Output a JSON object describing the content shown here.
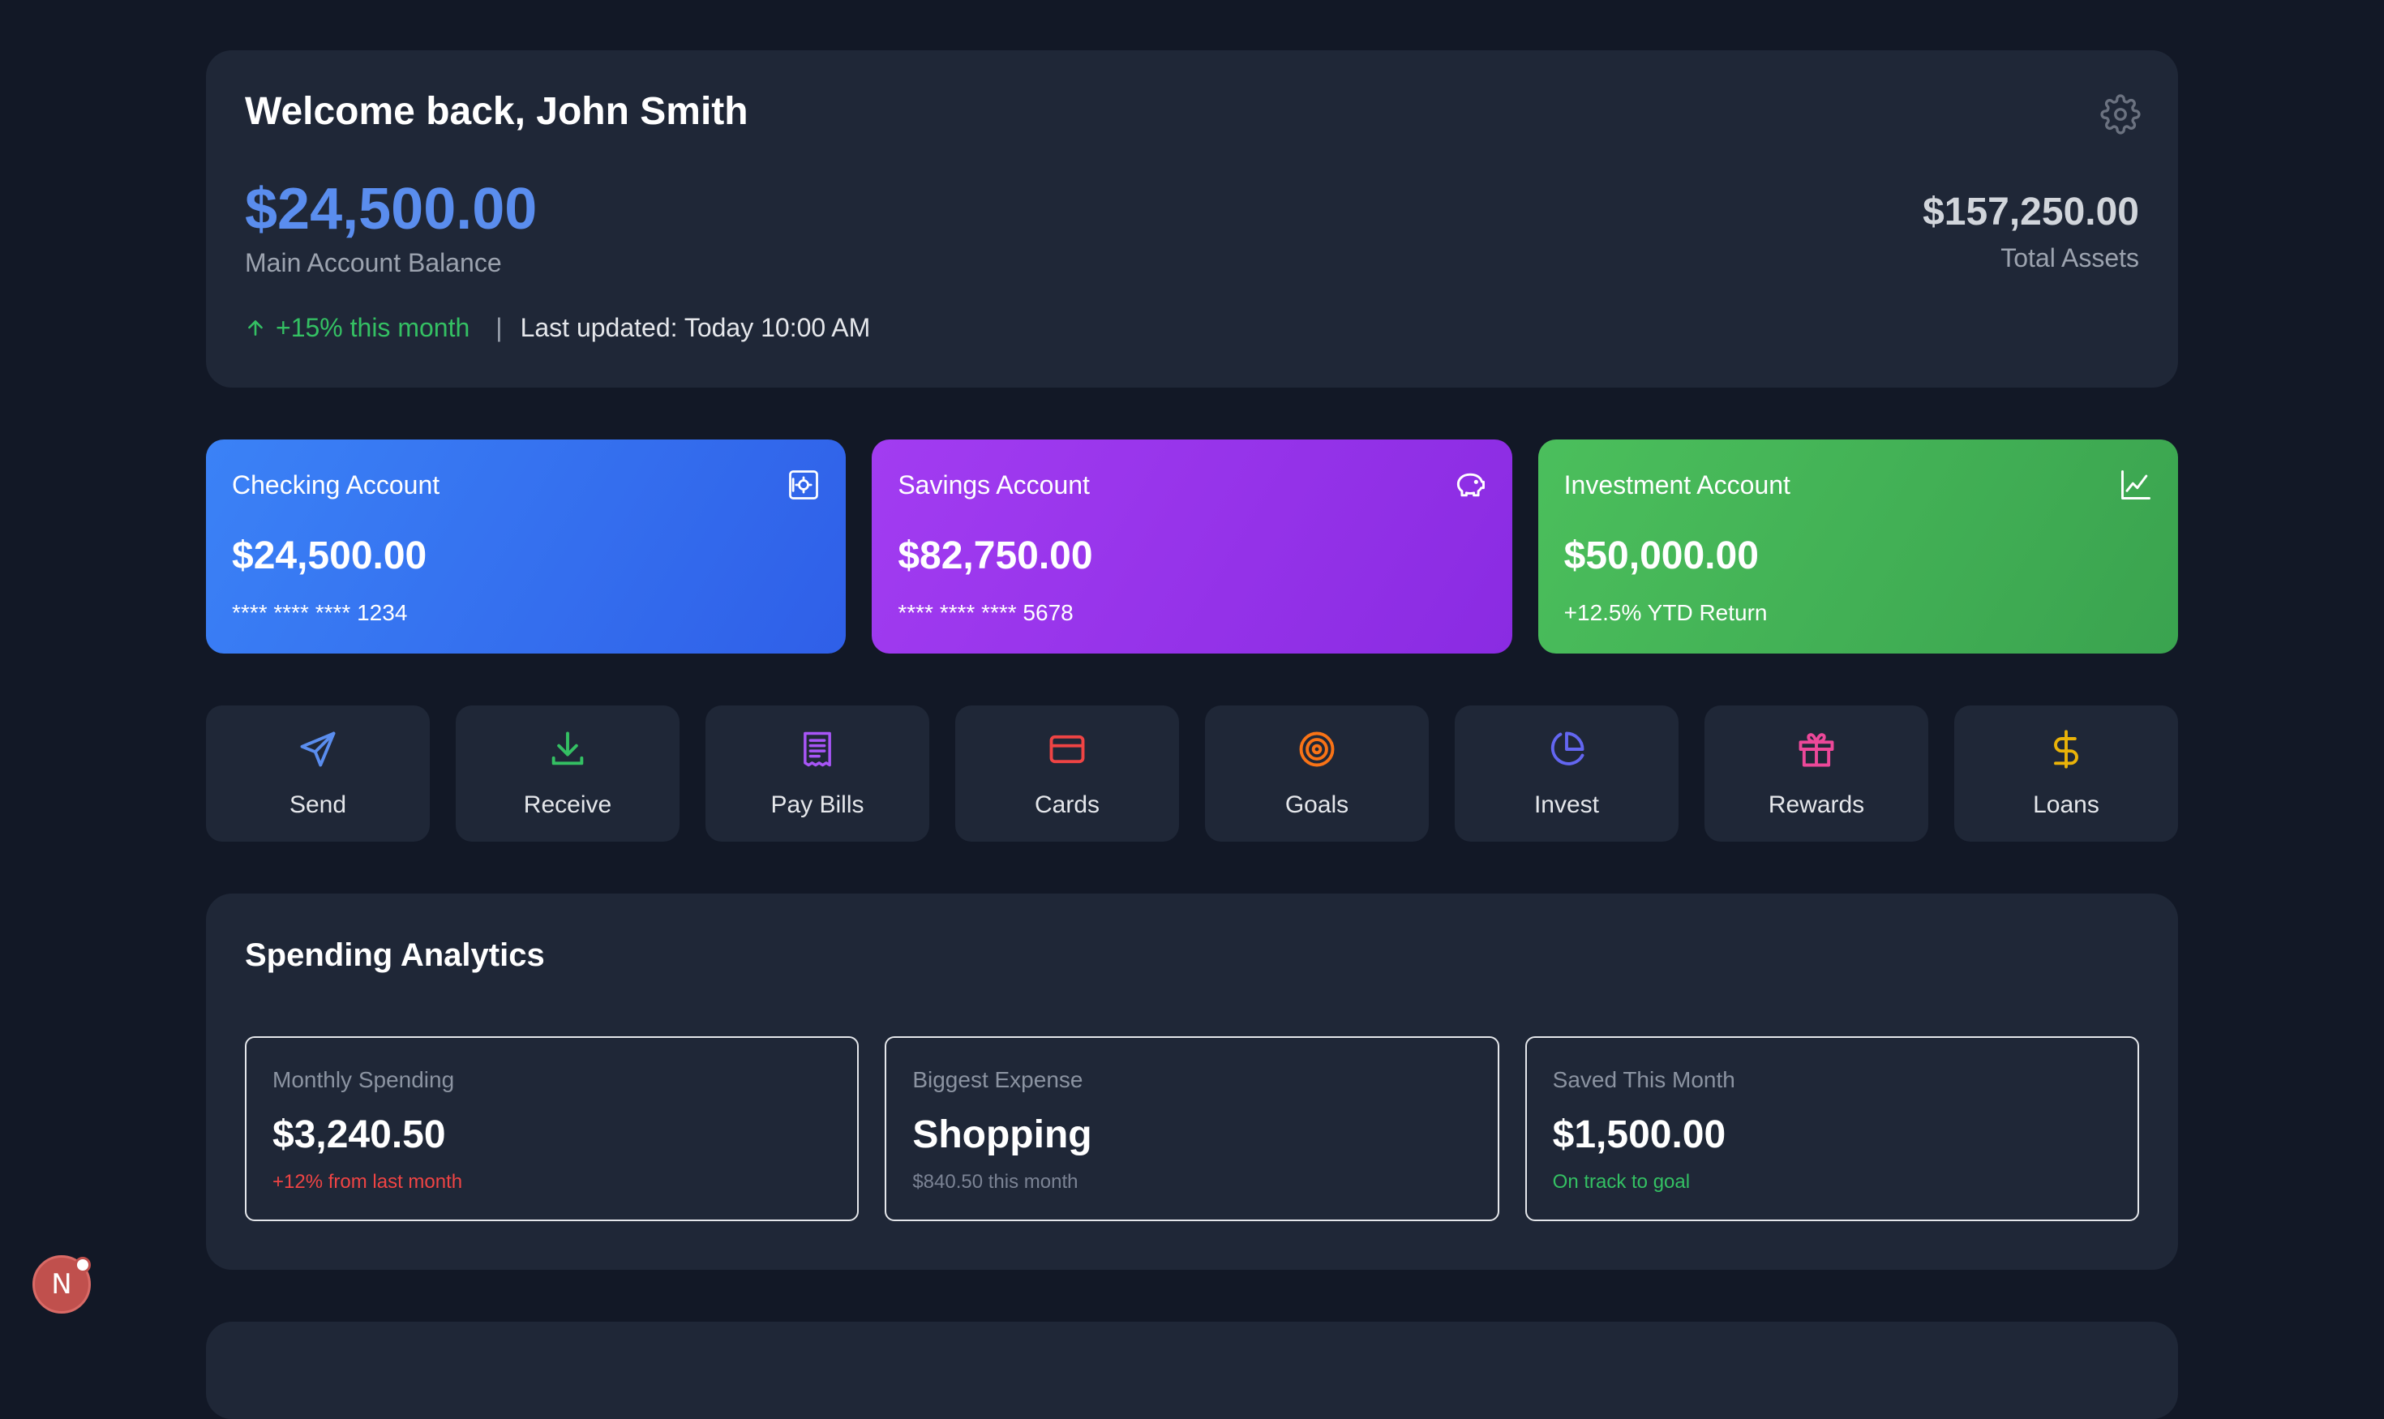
{
  "header": {
    "welcome": "Welcome back, John Smith",
    "main_balance": "$24,500.00",
    "main_balance_label": "Main Account Balance",
    "trend": "+15% this month",
    "separator": "|",
    "last_updated": "Last updated: Today 10:00 AM",
    "total_assets": "$157,250.00",
    "total_assets_label": "Total Assets"
  },
  "accounts": [
    {
      "name": "Checking Account",
      "amount": "$24,500.00",
      "sub": "**** **** **** 1234",
      "icon": "safe-icon",
      "color": "#3b82f6"
    },
    {
      "name": "Savings Account",
      "amount": "$82,750.00",
      "sub": "**** **** **** 5678",
      "icon": "piggy-bank-icon",
      "color": "#9333ea"
    },
    {
      "name": "Investment Account",
      "amount": "$50,000.00",
      "sub": "+12.5% YTD Return",
      "icon": "chart-line-icon",
      "color": "#4bbf5c"
    }
  ],
  "actions": [
    {
      "label": "Send",
      "icon": "send-icon",
      "color": "#5a8dee"
    },
    {
      "label": "Receive",
      "icon": "download-icon",
      "color": "#34c063"
    },
    {
      "label": "Pay Bills",
      "icon": "receipt-icon",
      "color": "#a855f7"
    },
    {
      "label": "Cards",
      "icon": "credit-card-icon",
      "color": "#ef4444"
    },
    {
      "label": "Goals",
      "icon": "target-icon",
      "color": "#f97316"
    },
    {
      "label": "Invest",
      "icon": "pie-chart-icon",
      "color": "#6366f1"
    },
    {
      "label": "Rewards",
      "icon": "gift-icon",
      "color": "#ec4899"
    },
    {
      "label": "Loans",
      "icon": "dollar-icon",
      "color": "#eab308"
    }
  ],
  "analytics": {
    "title": "Spending Analytics",
    "stats": [
      {
        "label": "Monthly Spending",
        "value": "$3,240.50",
        "note": "+12% from last month"
      },
      {
        "label": "Biggest Expense",
        "value": "Shopping",
        "note": "$840.50 this month"
      },
      {
        "label": "Saved This Month",
        "value": "$1,500.00",
        "note": "On track to goal"
      }
    ]
  },
  "fab": {
    "letter": "N"
  }
}
